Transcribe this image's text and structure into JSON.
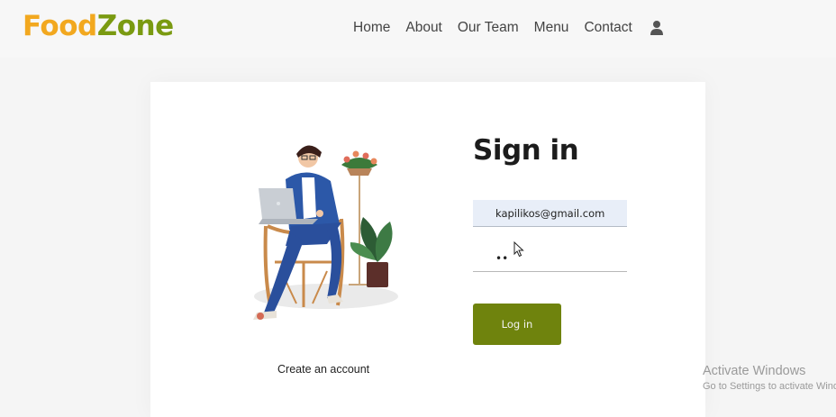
{
  "brand": {
    "part1": "Food",
    "part2": "Zone",
    "color1": "#f2a81f",
    "color2": "#7a9a11"
  },
  "nav": {
    "items": [
      {
        "label": "Home"
      },
      {
        "label": "About"
      },
      {
        "label": "Our Team"
      },
      {
        "label": "Menu"
      },
      {
        "label": "Contact"
      }
    ],
    "user_icon": "user-icon"
  },
  "login": {
    "title": "Sign in",
    "email_value": "kapilikos@gmail.com",
    "password_value": "••",
    "button_label": "Log in",
    "create_account": "Create an account",
    "button_color": "#6f830d"
  },
  "watermark": {
    "line1": "Activate Windows",
    "line2": "Go to Settings to activate Windows."
  }
}
